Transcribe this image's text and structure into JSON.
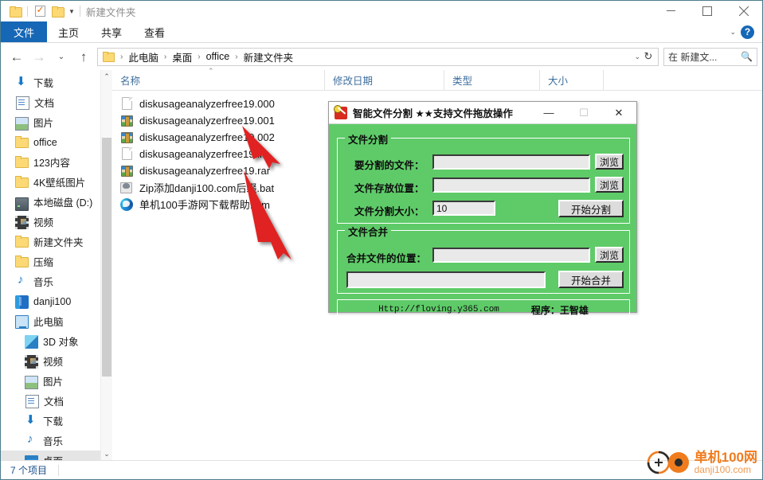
{
  "window": {
    "title": "新建文件夹",
    "quick_access": [
      "folder-icon",
      "properties-icon",
      "new-folder-icon",
      "dropdown-icon"
    ],
    "controls": {
      "minimize": "—",
      "maximize": "□",
      "close": "✕"
    }
  },
  "ribbon": {
    "tabs": [
      {
        "label": "文件",
        "active": true
      },
      {
        "label": "主页",
        "active": false
      },
      {
        "label": "共享",
        "active": false
      },
      {
        "label": "查看",
        "active": false
      }
    ],
    "collapse": "⌄",
    "help": "?"
  },
  "address": {
    "back": "←",
    "forward": "→",
    "recent": "⌄",
    "up": "↑",
    "crumbs": [
      "此电脑",
      "桌面",
      "office",
      "新建文件夹"
    ],
    "crumb_dropdown": "⌄",
    "refresh": "↻"
  },
  "search": {
    "placeholder": "在 新建文...",
    "icon": "search-icon"
  },
  "sidebar": {
    "items": [
      {
        "label": "下载",
        "icon": "download-icon",
        "pinned": true,
        "level": 1
      },
      {
        "label": "文档",
        "icon": "document-icon",
        "pinned": true,
        "level": 1
      },
      {
        "label": "图片",
        "icon": "pictures-icon",
        "pinned": true,
        "level": 1
      },
      {
        "label": "office",
        "icon": "folder-icon",
        "pinned": true,
        "level": 1
      },
      {
        "label": "123内容",
        "icon": "folder-icon",
        "pinned": true,
        "level": 1
      },
      {
        "label": "4K壁纸图片",
        "icon": "folder-icon",
        "pinned": true,
        "level": 1
      },
      {
        "label": "本地磁盘 (D:)",
        "icon": "drive-icon",
        "pinned": true,
        "level": 1
      },
      {
        "label": "视频",
        "icon": "video-icon",
        "pinned": false,
        "level": 1
      },
      {
        "label": "新建文件夹",
        "icon": "folder-icon",
        "pinned": false,
        "level": 1
      },
      {
        "label": "压缩",
        "icon": "folder-icon",
        "pinned": false,
        "level": 1
      },
      {
        "label": "音乐",
        "icon": "music-icon",
        "pinned": false,
        "level": 1
      },
      {
        "label": "danji100",
        "icon": "danji-icon",
        "pinned": false,
        "level": 1
      },
      {
        "label": "此电脑",
        "icon": "this-pc-icon",
        "pinned": false,
        "level": 1
      },
      {
        "label": "3D 对象",
        "icon": "3d-objects-icon",
        "pinned": false,
        "level": 2
      },
      {
        "label": "视频",
        "icon": "video-icon",
        "pinned": false,
        "level": 2
      },
      {
        "label": "图片",
        "icon": "pictures-icon",
        "pinned": false,
        "level": 2
      },
      {
        "label": "文档",
        "icon": "document-icon",
        "pinned": false,
        "level": 2
      },
      {
        "label": "下载",
        "icon": "download-icon",
        "pinned": false,
        "level": 2
      },
      {
        "label": "音乐",
        "icon": "music-icon",
        "pinned": false,
        "level": 2
      },
      {
        "label": "桌面",
        "icon": "desktop-icon",
        "pinned": false,
        "level": 2,
        "selected": true
      }
    ]
  },
  "filelist": {
    "columns": [
      "名称",
      "修改日期",
      "类型",
      "大小"
    ],
    "sort_indicator": "⌃",
    "rows": [
      {
        "name": "diskusageanalyzerfree19.000",
        "icon": "blank-file-icon"
      },
      {
        "name": "diskusageanalyzerfree19.001",
        "icon": "archive-icon"
      },
      {
        "name": "diskusageanalyzerfree19.002",
        "icon": "archive-icon"
      },
      {
        "name": "diskusageanalyzerfree19.lit",
        "icon": "blank-file-icon"
      },
      {
        "name": "diskusageanalyzerfree19.rar",
        "icon": "archive-icon"
      },
      {
        "name": "Zip添加danji100.com后缀.bat",
        "icon": "batch-file-icon"
      },
      {
        "name": "单机100手游网下载帮助.htm",
        "icon": "edge-browser-icon"
      }
    ]
  },
  "dialog": {
    "title": "智能文件分割  ★★支持文件拖放操作",
    "app_icon": "split-app-icon",
    "controls": {
      "minimize": "—",
      "maximize": "☐",
      "close": "✕"
    },
    "accent_color": "#5ecb68",
    "split_group": {
      "title": "文件分割",
      "source_label": "要分割的文件：",
      "source_value": "",
      "source_browse": "浏览",
      "dest_label": "文件存放位置：",
      "dest_value": "",
      "dest_browse": "浏览",
      "size_label": "文件分割大小：",
      "size_value": "10",
      "start_button": "开始分割"
    },
    "merge_group": {
      "title": "文件合并",
      "location_label": "合并文件的位置：",
      "location_value": "",
      "location_browse": "浏览",
      "progress_value": "",
      "start_button": "开始合并"
    },
    "footer": {
      "url": "Http://floving.y365.com",
      "author": "程序：王智雄"
    }
  },
  "status": {
    "count": "7 个项目"
  },
  "watermark": {
    "title": "单机100网",
    "domain": "danji100.com",
    "color": "#f07c1e"
  },
  "annotations": {
    "arrows": [
      {
        "name": "arrow-to-rar-file",
        "color": "#e02020"
      },
      {
        "name": "arrow-to-bat-file",
        "color": "#e02020"
      }
    ]
  }
}
